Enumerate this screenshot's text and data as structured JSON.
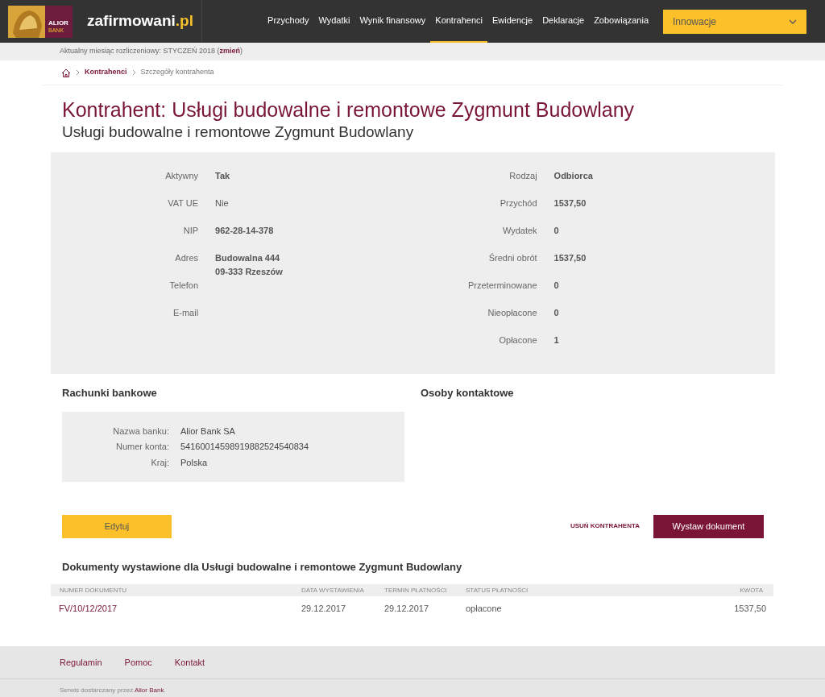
{
  "header": {
    "logo_text": [
      "ALIOR",
      "BANK"
    ],
    "brand": {
      "name": "zafirmowani",
      "suffix": ".pl"
    },
    "nav": [
      {
        "label": "Przychody",
        "selected": false
      },
      {
        "label": "Wydatki",
        "selected": false
      },
      {
        "label": "Wynik finansowy",
        "selected": false
      },
      {
        "label": "Kontrahenci",
        "selected": true
      },
      {
        "label": "Ewidencje",
        "selected": false
      },
      {
        "label": "Deklaracje",
        "selected": false
      },
      {
        "label": "Zobowiązania",
        "selected": false
      }
    ],
    "company_select": {
      "value": "Innowacje"
    }
  },
  "month_bar": {
    "text": "Aktualny miesiąc rozliczeniowy: STYCZEŃ 2018 (",
    "link": "zmień",
    "suffix": ")"
  },
  "breadcrumb": [
    {
      "label": "Kontrahenci"
    },
    {
      "label": "Szczegóły kontrahenta"
    }
  ],
  "title": "Kontrahent: Usługi budowalne i remontowe Zygmunt Budowlany",
  "subtitle": "Usługi budowalne i remontowe Zygmunt Budowlany",
  "details_left": [
    {
      "label": "Aktywny",
      "value": "Tak",
      "bold": true
    },
    {
      "label": "VAT UE",
      "value": "Nie",
      "bold": false
    },
    {
      "label": "NIP",
      "value": "962-28-14-378",
      "bold": true
    },
    {
      "label": "Adres",
      "value": "Budowalna 444\n09-333 Rzeszów",
      "bold": true
    },
    {
      "label": "Telefon"
    },
    {
      "label": "E-mail"
    }
  ],
  "details_right": [
    {
      "label": "Rodzaj",
      "value": "Odbiorca"
    },
    {
      "label": "Przychód",
      "value": "1537,50"
    },
    {
      "label": "Wydatek",
      "value": "0"
    },
    {
      "label": "Średni obrót",
      "value": "1537,50"
    },
    {
      "label": "Przeterminowane",
      "value": "0"
    },
    {
      "label": "Nieopłacone",
      "value": "0"
    },
    {
      "label": "Opłacone",
      "value": "1"
    }
  ],
  "bank_accounts": {
    "heading": "Rachunki bankowe",
    "fields": [
      {
        "label": "Nazwa banku:",
        "value": "Alior Bank SA"
      },
      {
        "label": "Numer konta:",
        "value": "54160014598919882524540834"
      },
      {
        "label": "Kraj:",
        "value": "Polska"
      }
    ]
  },
  "contacts": {
    "heading": "Osoby kontaktowe"
  },
  "buttons": {
    "edit": "Edytuj",
    "delete": "USUŃ KONTRAHENTA",
    "issue": "Wystaw dokument"
  },
  "documents": {
    "heading": "Dokumenty wystawione dla Usługi budowalne i remontowe Zygmunt Budowlany",
    "columns": [
      "NUMER DOKUMENTU",
      "DATA WYSTAWIENIA",
      "TERMIN PŁATNOŚCI",
      "STATUS PŁATNOŚCI",
      "KWOTA"
    ],
    "rows": [
      [
        "FV/10/12/2017",
        "29.12.2017",
        "29.12.2017",
        "opłacone",
        "1537,50"
      ]
    ]
  },
  "footer": {
    "links": [
      "Regulamin",
      "Pomoc",
      "Kontakt"
    ],
    "text": "Serwis dostarczany przez ",
    "link": "Alior Bank",
    "suffix": "."
  }
}
